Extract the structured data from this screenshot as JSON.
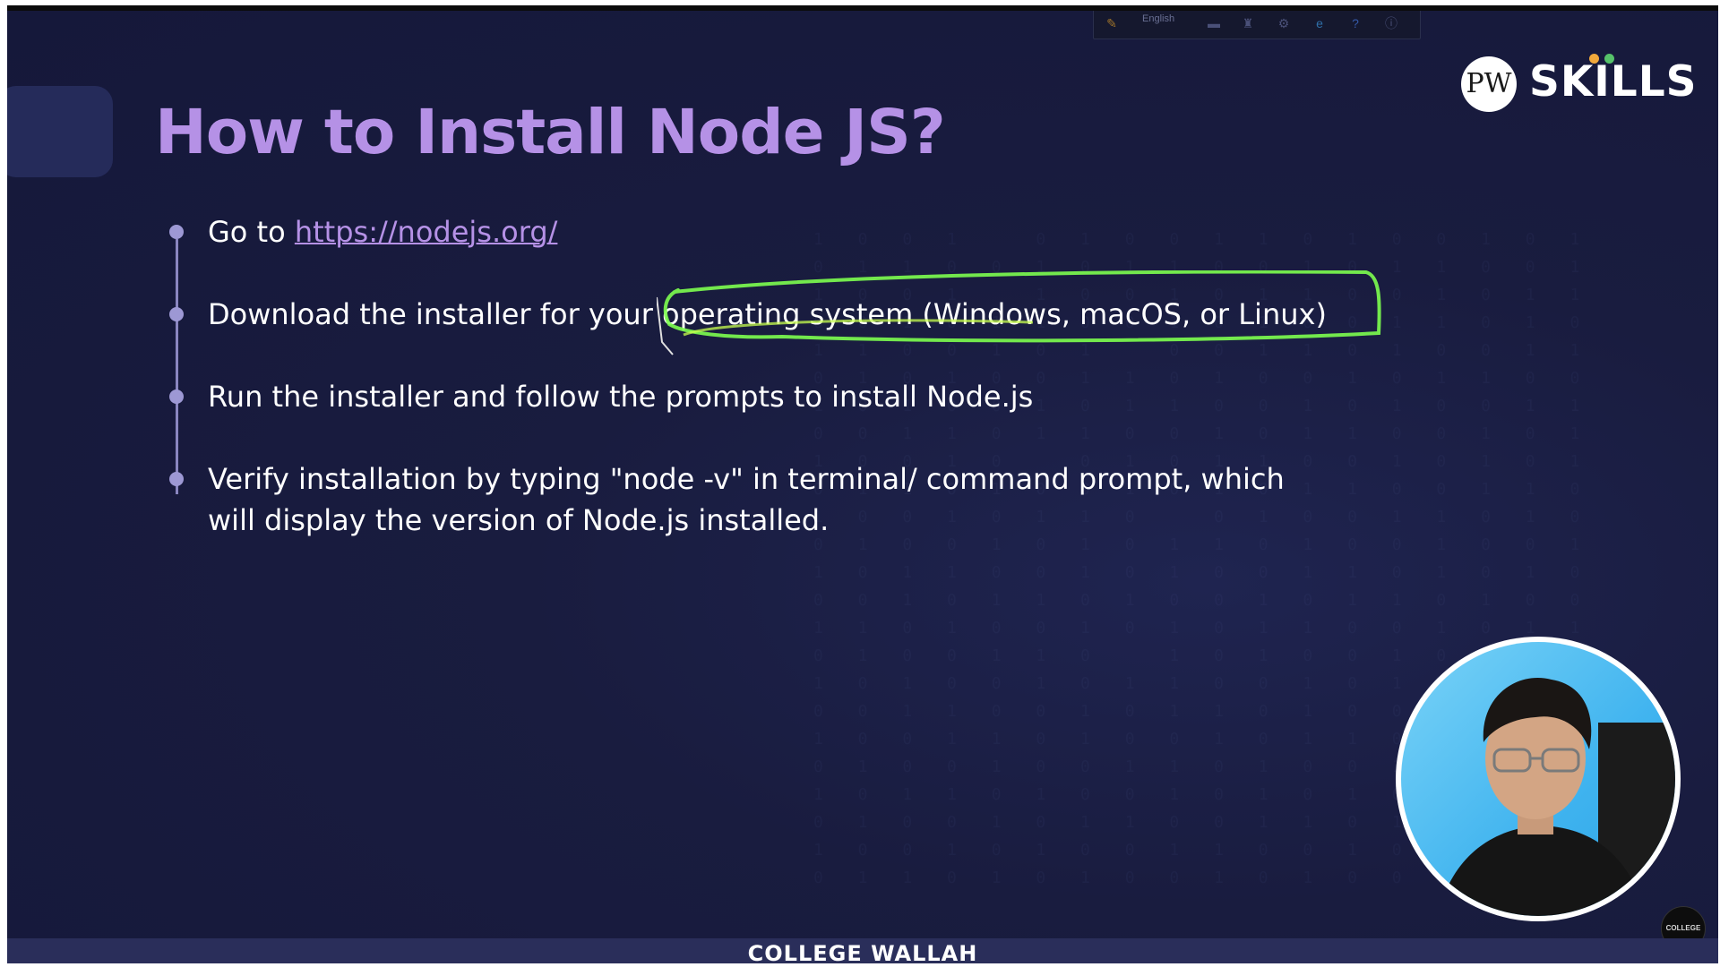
{
  "slide": {
    "title": "How to Install Node JS?",
    "items": [
      {
        "prefix": "Go to ",
        "link": "https://nodejs.org/"
      },
      {
        "text": "Download the installer for your operating system (Windows, macOS, or Linux)"
      },
      {
        "text": "Run the installer and follow the prompts to install Node.js"
      },
      {
        "line1": "Verify installation by typing \"node -v\" in terminal/ command prompt, which",
        "line2": "will display the version of Node.js installed."
      }
    ]
  },
  "logo": {
    "mark": "PW",
    "text": "SKILLS",
    "dot_colors": [
      "#f2a93b",
      "#56c26a"
    ]
  },
  "toolbar": {
    "language": "English",
    "icons": [
      "pen-icon",
      "highlighter-icon",
      "eraser-icon",
      "settings-icon",
      "edge-browser-icon",
      "help-icon",
      "info-icon"
    ]
  },
  "footer": {
    "brand": "COLLEGE WALLAH"
  },
  "watermark": {
    "text": "COLLEGE WALLAH"
  },
  "colors": {
    "accent": "#b591e6",
    "highlight_green": "#7dff4f",
    "background": "#191c3f"
  }
}
